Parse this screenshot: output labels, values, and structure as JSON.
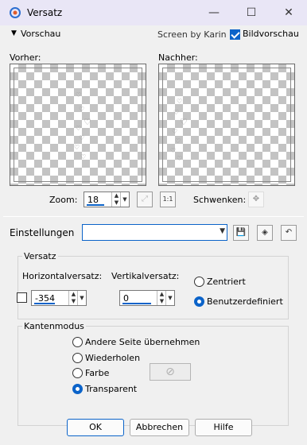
{
  "window": {
    "title": "Versatz",
    "minimize": "—",
    "maximize": "☐",
    "close": "✕"
  },
  "header": {
    "preview_toggle": "Vorschau",
    "screen_by": "Screen by Karin",
    "image_preview_label": "Bildvorschau",
    "image_preview_checked": true
  },
  "previews": {
    "before_label": "Vorher:",
    "after_label": "Nachher:"
  },
  "zoom": {
    "label": "Zoom:",
    "value": "18",
    "pan_label": "Schwenken:"
  },
  "settings": {
    "label": "Einstellungen",
    "value": ""
  },
  "offset": {
    "group_label": "Versatz",
    "horizontal_label": "Horizontalversatz:",
    "horizontal_value": "-354",
    "vertical_label": "Vertikalversatz:",
    "vertical_value": "0",
    "centered_label": "Zentriert",
    "custom_label": "Benutzerdefiniert",
    "selected": "custom"
  },
  "edge_mode": {
    "group_label": "Kantenmodus",
    "options": [
      "Andere Seite übernehmen",
      "Wiederholen",
      "Farbe",
      "Transparent"
    ],
    "selected": "Transparent"
  },
  "buttons": {
    "ok": "OK",
    "cancel": "Abbrechen",
    "help": "Hilfe"
  },
  "colors": {
    "accent": "#0b63c9",
    "titlebar": "#e9e6f6",
    "dialog_bg": "#f0f0f0"
  }
}
